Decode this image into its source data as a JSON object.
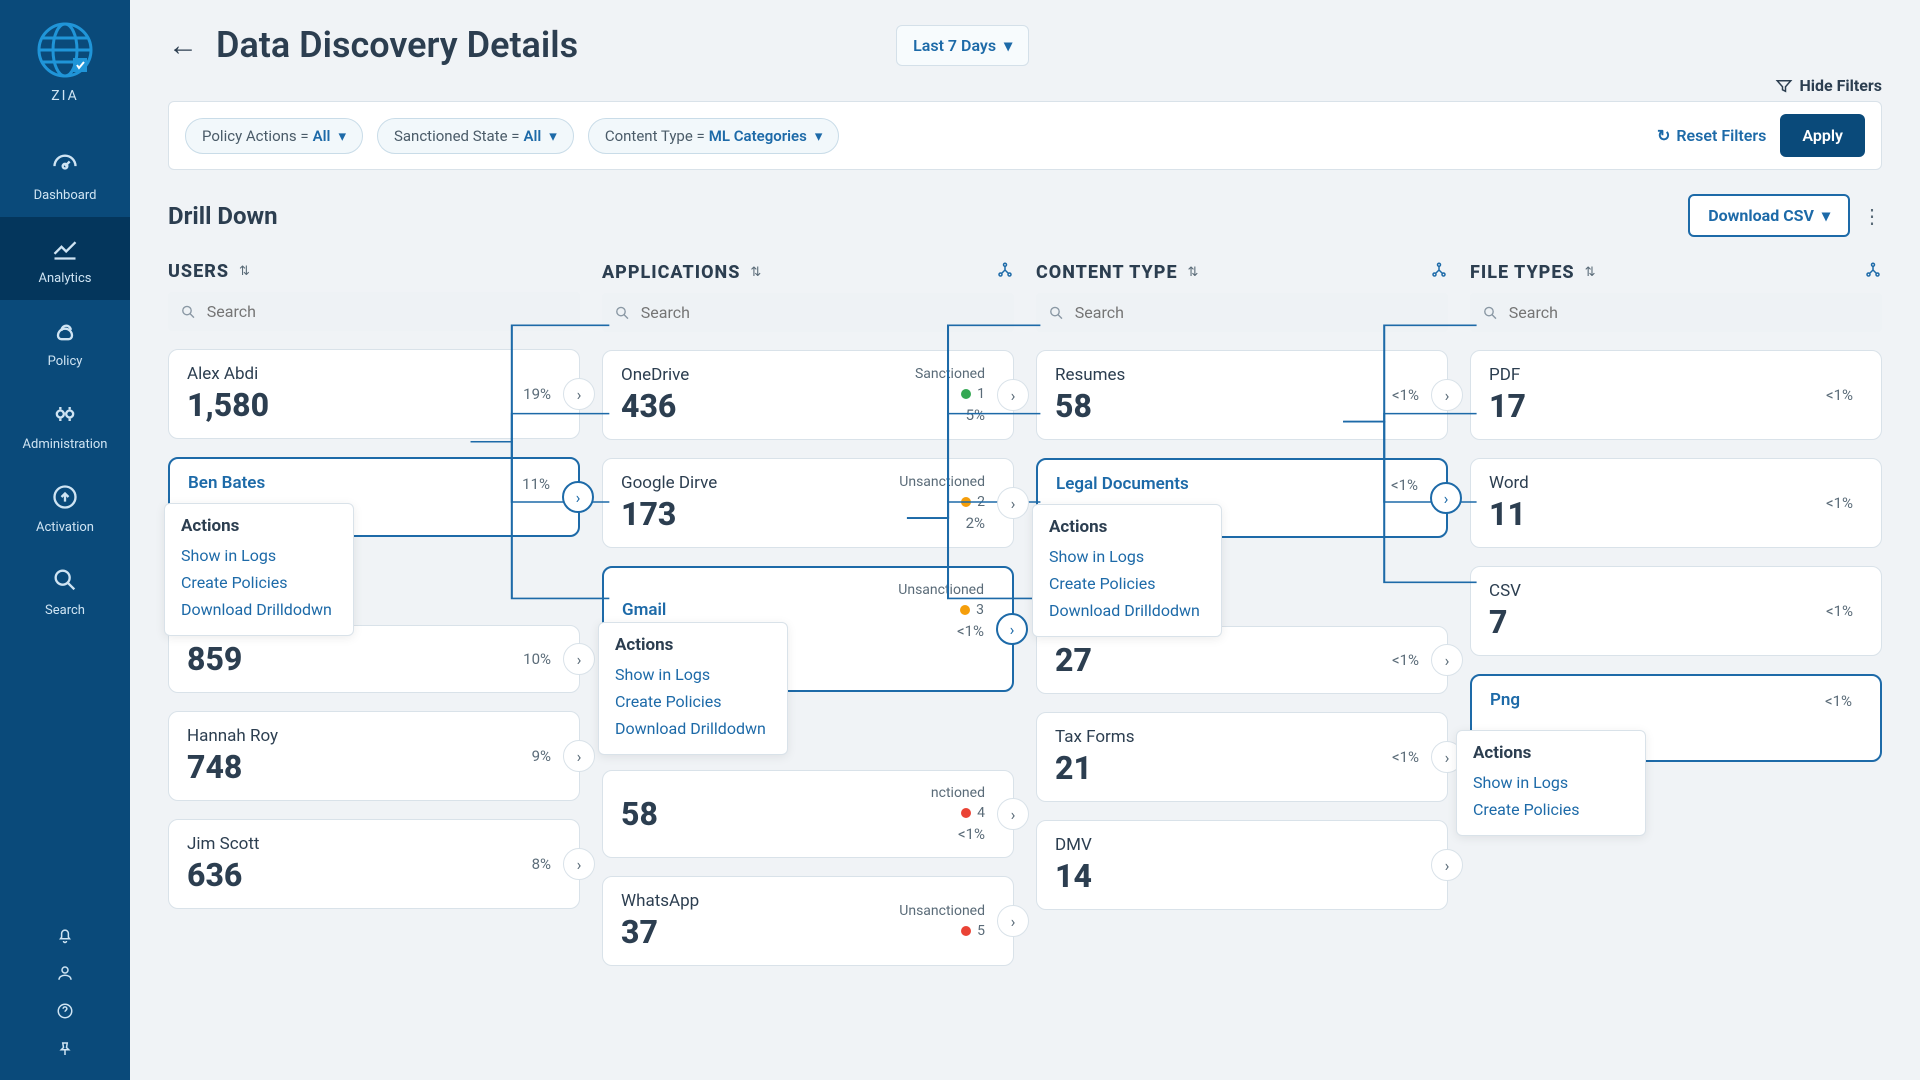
{
  "brand": "ZIA",
  "nav": {
    "items": [
      {
        "label": "Dashboard"
      },
      {
        "label": "Analytics"
      },
      {
        "label": "Policy"
      },
      {
        "label": "Administration"
      },
      {
        "label": "Activation"
      },
      {
        "label": "Search"
      }
    ]
  },
  "header": {
    "title": "Data Discovery Details",
    "time_range": "Last 7 Days",
    "hide_filters": "Hide Filters"
  },
  "filters": {
    "pills": [
      {
        "label": "Policy Actions =",
        "value": "All"
      },
      {
        "label": "Sanctioned State =",
        "value": "All"
      },
      {
        "label": "Content Type =",
        "value": "ML Categories"
      }
    ],
    "reset": "Reset Filters",
    "apply": "Apply"
  },
  "drilldown": {
    "title": "Drill Down",
    "download": "Download CSV"
  },
  "columns": {
    "users": {
      "title": "USERS",
      "search_placeholder": "Search",
      "items": [
        {
          "name": "Alex Abdi",
          "value": "1,580",
          "pct": "19%"
        },
        {
          "name": "Ben Bates",
          "value": "",
          "pct": "11%"
        },
        {
          "name": "",
          "value": "859",
          "pct": "10%"
        },
        {
          "name": "Hannah Roy",
          "value": "748",
          "pct": "9%"
        },
        {
          "name": "Jim Scott",
          "value": "636",
          "pct": "8%"
        }
      ]
    },
    "applications": {
      "title": "APPLICATIONS",
      "search_placeholder": "Search",
      "items": [
        {
          "name": "OneDrive",
          "value": "436",
          "pct": "5%",
          "status": "Sanctioned",
          "dot": "green",
          "n": "1"
        },
        {
          "name": "Google Dirve",
          "value": "173",
          "pct": "2%",
          "status": "Unsanctioned",
          "dot": "orange",
          "n": "2"
        },
        {
          "name": "Gmail",
          "value": "",
          "pct": "<1%",
          "status": "Unsanctioned",
          "dot": "orange",
          "n": "3"
        },
        {
          "name": "",
          "value": "58",
          "pct": "<1%",
          "status": "nctioned",
          "dot": "red",
          "n": "4"
        },
        {
          "name": "WhatsApp",
          "value": "37",
          "pct": "",
          "status": "Unsanctioned",
          "dot": "red",
          "n": "5"
        }
      ]
    },
    "content_type": {
      "title": "CONTENT TYPE",
      "search_placeholder": "Search",
      "items": [
        {
          "name": "Resumes",
          "value": "58",
          "pct": "<1%"
        },
        {
          "name": "Legal Documents",
          "value": "",
          "pct": "<1%"
        },
        {
          "name": "",
          "value": "27",
          "pct": "<1%"
        },
        {
          "name": "Tax Forms",
          "value": "21",
          "pct": "<1%"
        },
        {
          "name": "DMV",
          "value": "14",
          "pct": ""
        }
      ]
    },
    "file_types": {
      "title": "FILE TYPES",
      "search_placeholder": "Search",
      "items": [
        {
          "name": "PDF",
          "value": "17",
          "pct": "<1%"
        },
        {
          "name": "Word",
          "value": "11",
          "pct": "<1%"
        },
        {
          "name": "CSV",
          "value": "7",
          "pct": "<1%"
        },
        {
          "name": "Png",
          "value": "",
          "pct": "<1%"
        }
      ]
    }
  },
  "popup": {
    "title": "Actions",
    "links": [
      "Show in Logs",
      "Create Policies",
      "Download Drilldodwn"
    ]
  },
  "popup_short": {
    "title": "Actions",
    "links": [
      "Show in Logs",
      "Create Policies"
    ]
  }
}
